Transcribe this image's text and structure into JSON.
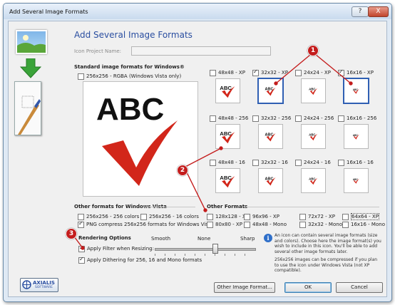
{
  "window": {
    "title": "Add Several Image Formats",
    "help_glyph": "?",
    "close_glyph": "X"
  },
  "header": {
    "title": "Add Several Image Formats",
    "project_name_label": "Icon Project Name:",
    "project_name_value": ""
  },
  "section_windows": {
    "title": "Standard image formats for Windows®",
    "preview_option": "256x256 - RGBA (Windows Vista only)",
    "preview_text": "ABC",
    "rows": [
      [
        {
          "label": "48x48 - XP",
          "checked": false,
          "selected": false
        },
        {
          "label": "32x32 - XP",
          "checked": true,
          "selected": true
        },
        {
          "label": "24x24 - XP",
          "checked": false,
          "selected": false
        },
        {
          "label": "16x16 - XP",
          "checked": true,
          "selected": true
        }
      ],
      [
        {
          "label": "48x48 - 256",
          "checked": false,
          "selected": false
        },
        {
          "label": "32x32 - 256",
          "checked": false,
          "selected": false
        },
        {
          "label": "24x24 - 256",
          "checked": false,
          "selected": false
        },
        {
          "label": "16x16 - 256",
          "checked": false,
          "selected": false
        }
      ],
      [
        {
          "label": "48x48 - 16",
          "checked": false,
          "selected": false
        },
        {
          "label": "32x32 - 16",
          "checked": false,
          "selected": false
        },
        {
          "label": "24x24 - 16",
          "checked": false,
          "selected": false
        },
        {
          "label": "16x16 - 16",
          "checked": false,
          "selected": false
        }
      ]
    ]
  },
  "section_vista": {
    "title": "Other formats for Windows Vista",
    "options": [
      {
        "label": "256x256 - 256 colors",
        "checked": false
      },
      {
        "label": "256x256 - 16 colors",
        "checked": false
      },
      {
        "label": "PNG compress 256x256 formats for Windows Vista",
        "checked": true
      }
    ]
  },
  "section_other": {
    "title": "Other Formats",
    "options": [
      {
        "label": "128x128 - XP",
        "checked": false
      },
      {
        "label": "96x96 - XP",
        "checked": false
      },
      {
        "label": "72x72 - XP",
        "checked": false
      },
      {
        "label": "64x64 - XP",
        "checked": false
      },
      {
        "label": "80x80 - XP",
        "checked": false
      },
      {
        "label": "48x48 - Mono",
        "checked": false
      },
      {
        "label": "32x32 - Mono",
        "checked": false
      },
      {
        "label": "16x16 - Mono",
        "checked": false
      }
    ]
  },
  "rendering": {
    "title": "Rendering Options",
    "filter_label": "Apply Filter when Resizing:",
    "filter_checked": true,
    "dither_label": "Apply Dithering for 256, 16 and Mono formats",
    "dither_checked": true,
    "slider_smooth": "Smooth",
    "slider_none": "None",
    "slider_sharp": "Sharp",
    "slider_value_fraction": 0.6
  },
  "info": {
    "text1": "An icon can contain several image formats (size and colors). Choose here the image format(s) you wish to include in this icon. You'll be able to add several other image formats later.",
    "text2": "256x256 images can be compressed if you plan to use the icon under Windows Vista (not XP compatible)."
  },
  "buttons": {
    "other": "Other Image Format...",
    "ok": "OK",
    "cancel": "Cancel"
  },
  "logo": {
    "name": "AXIALIS",
    "sub": "SOFTWARE"
  },
  "callouts": [
    "1",
    "2",
    "3"
  ],
  "colors": {
    "accent": "#2a4ea0",
    "callout": "#c41d1d",
    "check_red": "#d2261a"
  }
}
